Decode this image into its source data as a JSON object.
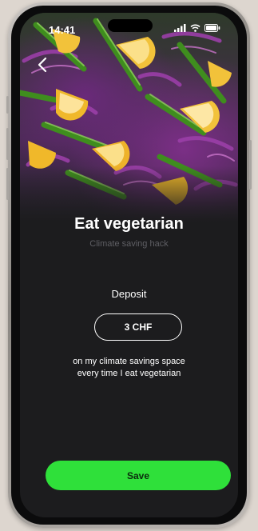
{
  "status_bar": {
    "time": "14:41"
  },
  "hero": {
    "image": "grilled-vegetables-photo"
  },
  "header": {
    "title": "Eat vegetarian",
    "subtitle": "Climate saving hack"
  },
  "deposit": {
    "label": "Deposit",
    "amount": "3 CHF",
    "description_line1": "on my climate savings space",
    "description_line2": "every time I eat vegetarian"
  },
  "actions": {
    "save_label": "Save"
  },
  "colors": {
    "accent": "#2fe03a",
    "background": "#1c1c1e",
    "subtitle": "#5f5f64"
  },
  "icons": [
    "back-chevron-icon",
    "signal-icon",
    "wifi-icon",
    "battery-icon"
  ]
}
